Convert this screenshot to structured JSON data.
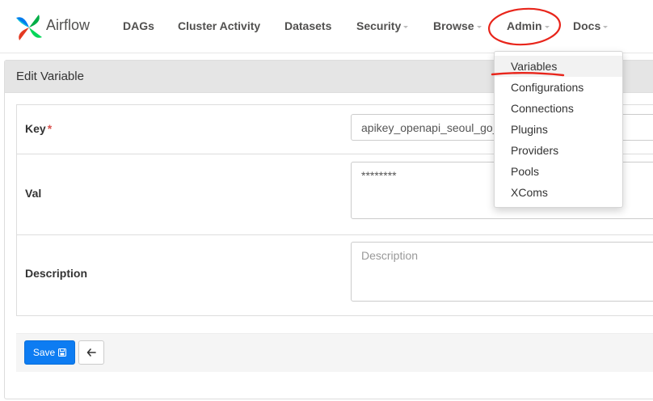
{
  "brand": {
    "name": "Airflow"
  },
  "nav": {
    "dags": "DAGs",
    "cluster_activity": "Cluster Activity",
    "datasets": "Datasets",
    "security": "Security",
    "browse": "Browse",
    "admin": "Admin",
    "docs": "Docs"
  },
  "admin_menu": {
    "items": [
      "Variables",
      "Configurations",
      "Connections",
      "Plugins",
      "Providers",
      "Pools",
      "XComs"
    ]
  },
  "panel": {
    "title": "Edit Variable"
  },
  "form": {
    "key_label": "Key",
    "required_mark": "*",
    "key_value": "apikey_openapi_seoul_go_",
    "val_label": "Val",
    "val_value": "********",
    "description_label": "Description",
    "description_placeholder": "Description"
  },
  "actions": {
    "save_label": "Save"
  },
  "colors": {
    "primary": "#0d7cf2",
    "annotation": "#e8251b"
  }
}
